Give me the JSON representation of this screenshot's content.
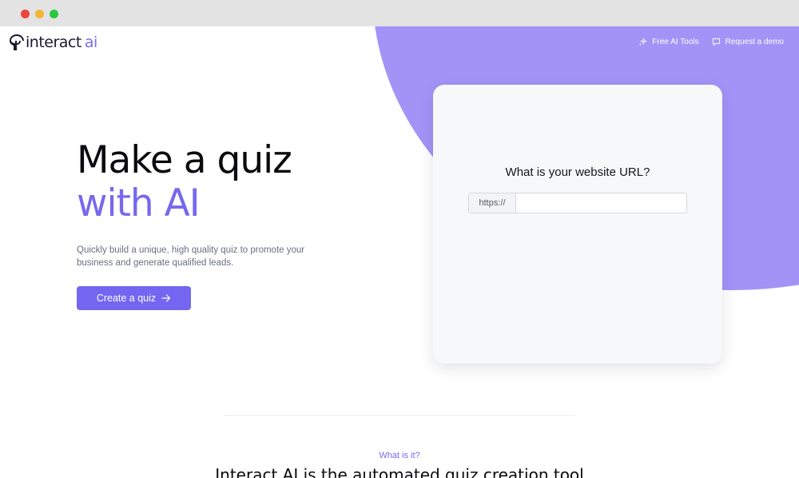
{
  "window": {
    "controls": [
      "close",
      "minimize",
      "maximize"
    ]
  },
  "brand": {
    "name": "interact",
    "suffix": "ai",
    "accent": "#7a6ef0"
  },
  "nav": {
    "items": [
      {
        "label": "Free AI Tools",
        "icon": "sparkle-icon"
      },
      {
        "label": "Request a demo",
        "icon": "chat-bubble-icon"
      }
    ]
  },
  "hero": {
    "title_line1": "Make a quiz",
    "title_line2": "with AI",
    "subtitle": "Quickly build a unique, high quality quiz to promote your business and generate qualified leads.",
    "cta_label": "Create a quiz",
    "cta_icon": "arrow-right-icon"
  },
  "card": {
    "question": "What is your website URL?",
    "url_prefix": "https://",
    "url_value": "",
    "url_placeholder": ""
  },
  "section": {
    "eyebrow": "What is it?",
    "heading": "Interact AI is the automated quiz creation tool"
  },
  "colors": {
    "primary": "#7466f0",
    "blob": "#a393f7",
    "card_bg": "#f7f8f9"
  }
}
